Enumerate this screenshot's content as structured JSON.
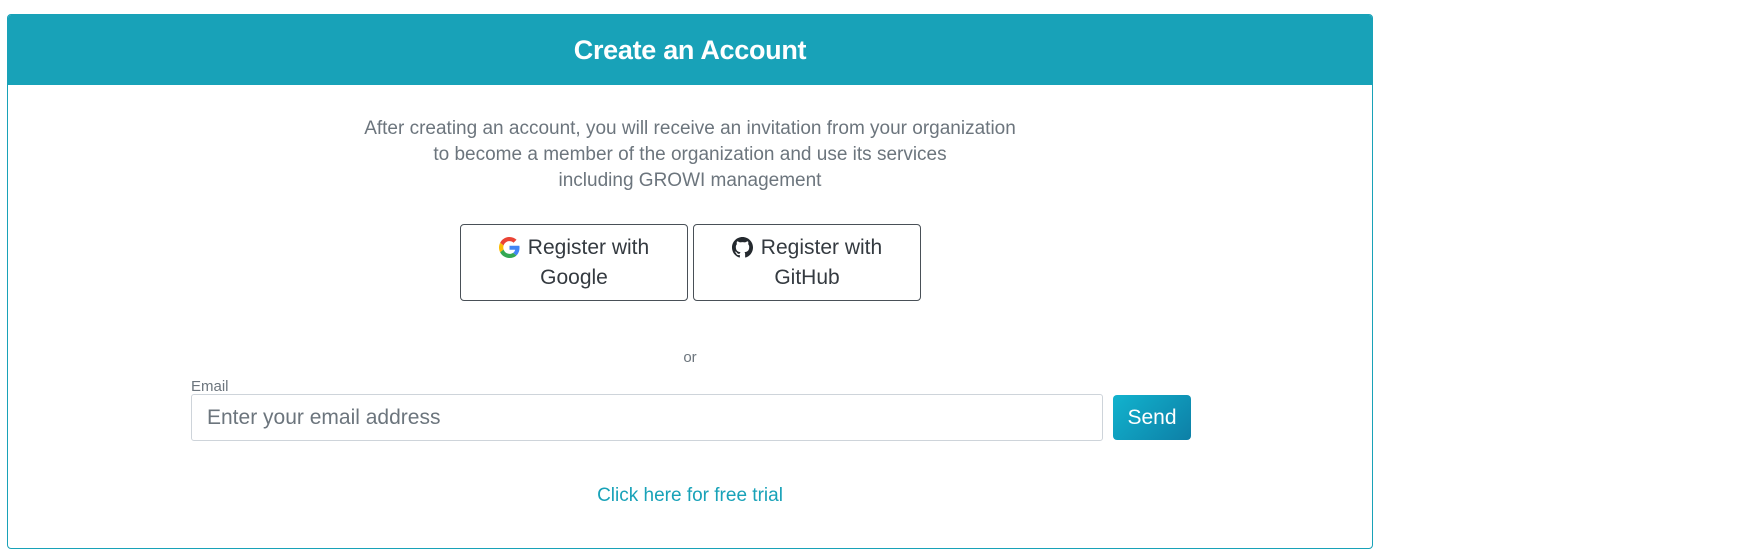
{
  "card": {
    "title": "Create an Account",
    "intro_lines": [
      "After creating an account, you will receive an invitation from your organization",
      "to become a member of the organization and use its services",
      "including GROWI management"
    ]
  },
  "social": {
    "google": {
      "line1": "Register with",
      "line2": "Google",
      "icon": "google-icon"
    },
    "github": {
      "line1": "Register with",
      "line2": "GitHub",
      "icon": "github-icon"
    }
  },
  "divider_text": "or",
  "email": {
    "label": "Email",
    "value": "",
    "placeholder": "Enter your email address",
    "submit_label": "Send"
  },
  "trial_link": "Click here for free trial",
  "colors": {
    "brand": "#18a2b8",
    "send_gradient_start": "#12b3ce",
    "send_gradient_end": "#0d7fa6",
    "muted_text": "#6c757d"
  }
}
